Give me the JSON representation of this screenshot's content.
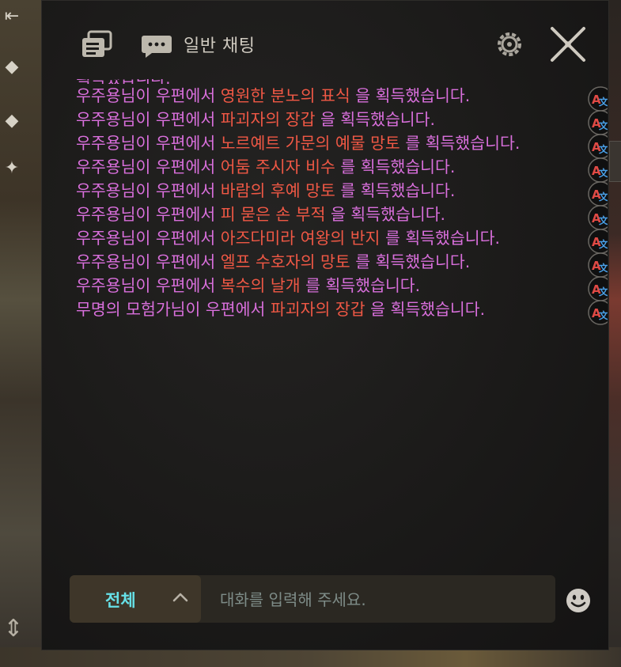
{
  "header": {
    "title": "일반 채팅"
  },
  "messages": [
    {
      "pre": "",
      "item": "",
      "post": "획득했습니다.",
      "partial": true
    },
    {
      "pre": "우주용님이 우편에서 ",
      "item": "영원한 분노의 표식",
      "post": "  을 획득했습니다."
    },
    {
      "pre": "우주용님이 우편에서 ",
      "item": "파괴자의 장갑",
      "post": "  을 획득했습니다."
    },
    {
      "pre": "우주용님이 우편에서 ",
      "item": "노르예트 가문의 예물 망토",
      "post": "  를 획득했습니다."
    },
    {
      "pre": "우주용님이 우편에서 ",
      "item": "어둠 주시자 비수",
      "post": "  를 획득했습니다."
    },
    {
      "pre": "우주용님이 우편에서 ",
      "item": "바람의 후예 망토",
      "post": "  를 획득했습니다."
    },
    {
      "pre": "우주용님이 우편에서 ",
      "item": "피 묻은 손 부적",
      "post": "  을 획득했습니다."
    },
    {
      "pre": "우주용님이 우편에서 ",
      "item": "아즈다미라 여왕의 반지",
      "post": "  를 획득했습니다."
    },
    {
      "pre": "우주용님이 우편에서 ",
      "item": "엘프 수호자의 망토",
      "post": "  를 획득했습니다."
    },
    {
      "pre": "우주용님이 우편에서 ",
      "item": "복수의 날개",
      "post": "  를 획득했습니다."
    },
    {
      "pre": "무명의 모험가님이 우편에서 ",
      "item": "파괴자의 장갑",
      "post": "  을 획득했습니다."
    }
  ],
  "input": {
    "channel_label": "전체",
    "placeholder": "대화를 입력해 주세요.",
    "value": ""
  },
  "colors": {
    "sender_text": "#d96fdc",
    "item_text": "#f05845",
    "channel_label": "#66e0e7"
  },
  "icons": {
    "header_left": "chat-list-icon",
    "header_chat": "speech-bubble-icon",
    "settings": "gear-icon",
    "close": "close-icon",
    "translate": "translate-icon",
    "channel_toggle": "chevron-up-icon",
    "emoji": "emoji-icon"
  }
}
